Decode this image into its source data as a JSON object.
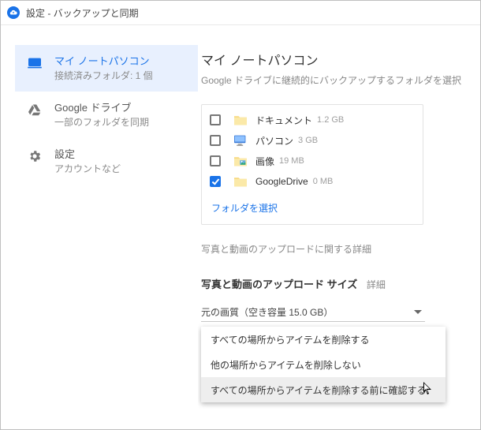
{
  "window": {
    "title": "設定 - バックアップと同期"
  },
  "sidebar": {
    "items": [
      {
        "title": "マイ ノートパソコン",
        "subtitle": "接続済みフォルダ: 1 個",
        "icon": "laptop-icon"
      },
      {
        "title": "Google ドライブ",
        "subtitle": "一部のフォルダを同期",
        "icon": "drive-icon"
      },
      {
        "title": "設定",
        "subtitle": "アカウントなど",
        "icon": "gear-icon"
      }
    ]
  },
  "main": {
    "title": "マイ ノートパソコン",
    "subtitle": "Google ドライブに継続的にバックアップするフォルダを選択",
    "folders": [
      {
        "name": "ドキュメント",
        "size": "1.2 GB",
        "checked": false,
        "icon": "folder-doc-icon"
      },
      {
        "name": "パソコン",
        "size": "3 GB",
        "checked": false,
        "icon": "computer-icon"
      },
      {
        "name": "画像",
        "size": "19 MB",
        "checked": false,
        "icon": "folder-pic-icon"
      },
      {
        "name": "GoogleDrive",
        "size": "0 MB",
        "checked": true,
        "icon": "folder-icon"
      }
    ],
    "choose_folder": "フォルダを選択",
    "photo_link": "写真と動画のアップロードに関する詳細",
    "upload_size_heading": "写真と動画のアップロード サイズ",
    "upload_size_link": "詳細",
    "quality_value": "元の画質（空き容量 15.0 GB）",
    "menu": {
      "items": [
        "すべての場所からアイテムを削除する",
        "他の場所からアイテムを削除しない",
        "すべての場所からアイテムを削除する前に確認する"
      ],
      "highlighted": 2
    }
  }
}
